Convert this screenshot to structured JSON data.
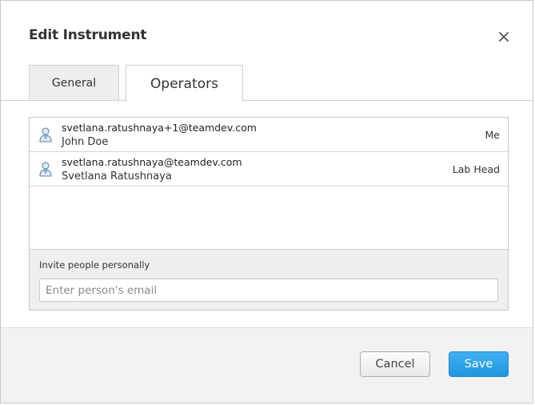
{
  "dialog": {
    "title": "Edit Instrument",
    "close_icon": "close-icon"
  },
  "tabs": [
    {
      "label": "General",
      "active": false
    },
    {
      "label": "Operators",
      "active": true
    }
  ],
  "operators": [
    {
      "email": "svetlana.ratushnaya+1@teamdev.com",
      "name": "John Doe",
      "role": "Me",
      "icon": "user-avatar-icon"
    },
    {
      "email": "svetlana.ratushnaya@teamdev.com",
      "name": "Svetlana Ratushnaya",
      "role": "Lab Head",
      "icon": "user-avatar-icon"
    }
  ],
  "invite": {
    "label": "Invite people personally",
    "placeholder": "Enter person's email",
    "value": ""
  },
  "footer": {
    "cancel_label": "Cancel",
    "save_label": "Save"
  },
  "colors": {
    "accent": "#2a9fe6",
    "tab_inactive_bg": "#eeeeee",
    "footer_bg": "#f2f2f2"
  }
}
